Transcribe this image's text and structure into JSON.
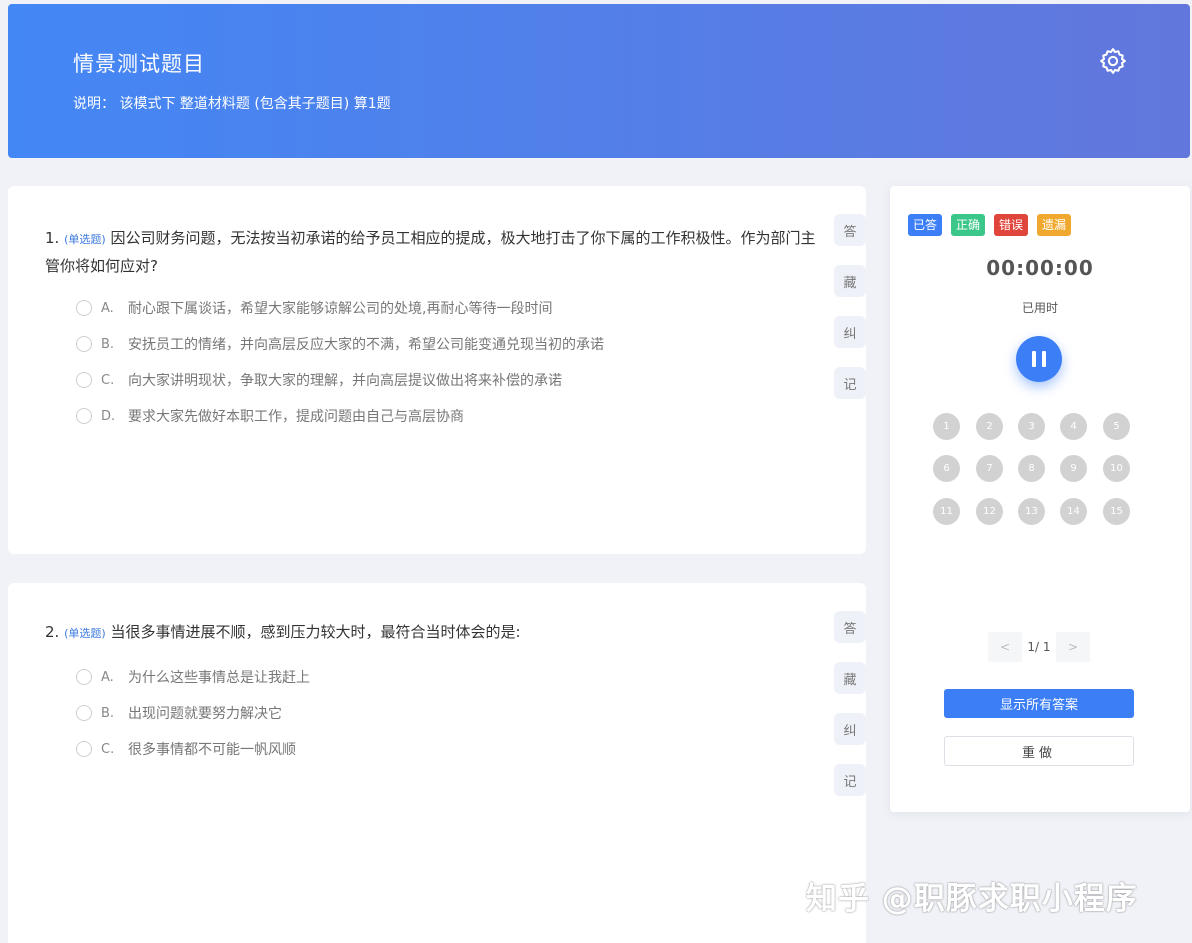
{
  "header": {
    "title": "情景测试题目",
    "description": "说明：  该模式下 整道材料题 (包含其子题目) 算1题",
    "settings_icon": "gear-icon"
  },
  "questions": [
    {
      "number": "1.",
      "tag": "(单选题)",
      "text": "因公司财务问题，无法按当初承诺的给予员工相应的提成，极大地打击了你下属的工作积极性。作为部门主管你将如何应对?",
      "options": [
        {
          "letter": "A.",
          "text": "耐心跟下属谈话，希望大家能够谅解公司的处境,再耐心等待一段时间"
        },
        {
          "letter": "B.",
          "text": "安抚员工的情绪，并向高层反应大家的不满，希望公司能变通兑现当初的承诺"
        },
        {
          "letter": "C.",
          "text": "向大家讲明现状，争取大家的理解，并向高层提议做出将来补偿的承诺"
        },
        {
          "letter": "D.",
          "text": "要求大家先做好本职工作，提成问题由自己与高层协商"
        }
      ],
      "side": [
        "答",
        "藏",
        "纠",
        "记"
      ]
    },
    {
      "number": "2.",
      "tag": "(单选题)",
      "text": "当很多事情进展不顺，感到压力较大时，最符合当时体会的是:",
      "options": [
        {
          "letter": "A.",
          "text": "为什么这些事情总是让我赶上"
        },
        {
          "letter": "B.",
          "text": "出现问题就要努力解决它"
        },
        {
          "letter": "C.",
          "text": "很多事情都不可能一帆风顺"
        }
      ],
      "side": [
        "答",
        "藏",
        "纠",
        "记"
      ]
    }
  ],
  "panel": {
    "legend": [
      {
        "label": "已答",
        "color": "#3c7ef5"
      },
      {
        "label": "正确",
        "color": "#3cc78a"
      },
      {
        "label": "错误",
        "color": "#e0453c"
      },
      {
        "label": "遗漏",
        "color": "#f0a92e"
      }
    ],
    "timer": "00:00:00",
    "timer_label": "已用时",
    "pause_icon": "pause-icon",
    "numbers": [
      "1",
      "2",
      "3",
      "4",
      "5",
      "6",
      "7",
      "8",
      "9",
      "10",
      "11",
      "12",
      "13",
      "14",
      "15"
    ],
    "pager": {
      "prev": "<",
      "text": "1/ 1",
      "next": ">"
    },
    "show_answers": "显示所有答案",
    "redo": "重做"
  },
  "watermark": "知乎 @职豚求职小程序"
}
